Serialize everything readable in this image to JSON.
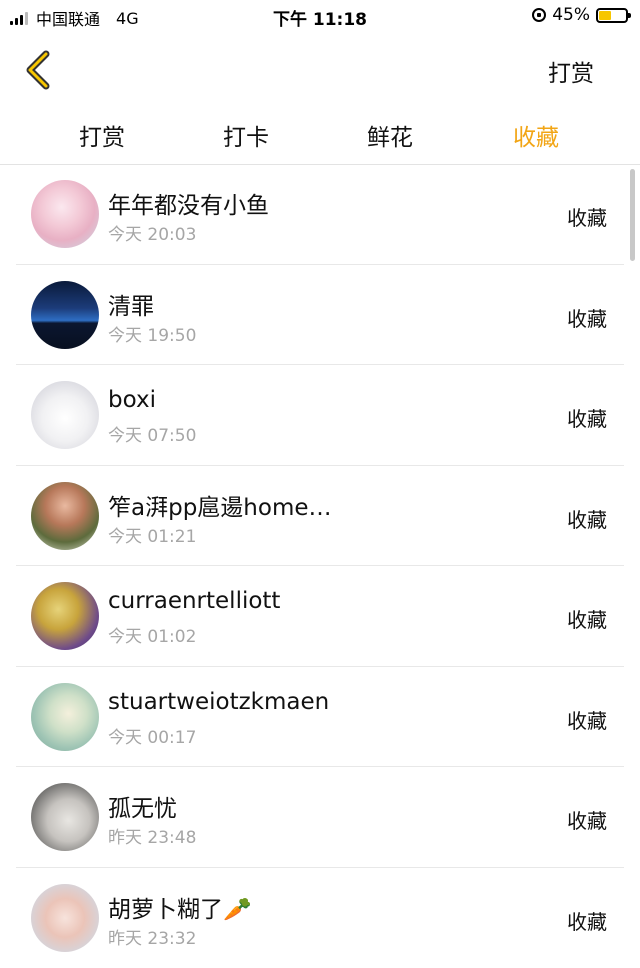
{
  "status_bar": {
    "carrier": "中国联通",
    "network": "4G",
    "time": "下午 11:18",
    "battery_percent": "45%",
    "battery_level": 0.45,
    "battery_color": "#f7c600"
  },
  "navbar": {
    "back_icon": "chevron-left-icon",
    "action_label": "打赏"
  },
  "tabs": [
    {
      "label": "打赏",
      "active": false
    },
    {
      "label": "打卡",
      "active": false
    },
    {
      "label": "鲜花",
      "active": false
    },
    {
      "label": "收藏",
      "active": true
    }
  ],
  "accent_color": "#f2a515",
  "list": [
    {
      "name": "年年都没有小鱼",
      "time": "今天 20:03",
      "action": "收藏"
    },
    {
      "name": "清罪",
      "time": "今天 19:50",
      "action": "收藏"
    },
    {
      "name": "boxi",
      "time": "今天 07:50",
      "action": "收藏"
    },
    {
      "name": "笮a湃pp扈逿home…",
      "time": "今天 01:21",
      "action": "收藏"
    },
    {
      "name": "curraenrtelliott",
      "time": "今天 01:02",
      "action": "收藏"
    },
    {
      "name": "stuartweiotzkmaen",
      "time": "今天 00:17",
      "action": "收藏"
    },
    {
      "name": "孤无忧",
      "time": "昨天 23:48",
      "action": "收藏"
    },
    {
      "name": "胡萝卜糊了🥕",
      "time": "昨天 23:32",
      "action": "收藏"
    }
  ]
}
